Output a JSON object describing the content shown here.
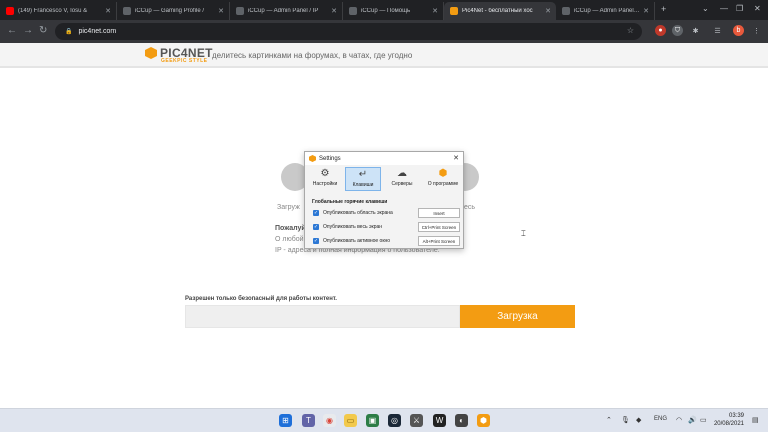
{
  "browser": {
    "tabs": [
      {
        "title": "(149) Francesco V, Iosu &",
        "favicon": "youtube-icon",
        "color": "#ff0000"
      },
      {
        "title": "iCCup — Gaming Profile /",
        "favicon": "iccup-icon",
        "color": "#5f6368"
      },
      {
        "title": "iCCup — Admin Panel / IP",
        "favicon": "iccup-icon",
        "color": "#5f6368"
      },
      {
        "title": "iCCup — Помощь",
        "favicon": "iccup-icon",
        "color": "#5f6368"
      },
      {
        "title": "Pic4Net - бесплатный хос",
        "favicon": "pic4net-icon",
        "color": "#f39c12",
        "active": true
      },
      {
        "title": "iCCup — Admin Panel / IP",
        "favicon": "iccup-icon",
        "color": "#5f6368"
      }
    ],
    "new_tab": "+",
    "url": "pic4net.com"
  },
  "site": {
    "logo_name": "PIC4NET",
    "logo_sub": "GEEKPIC STYLE",
    "tagline": "делитесь картинками на форумах, в чатах, где угодно",
    "bg_text_left": "Загруж",
    "bg_text_right": "есь",
    "bg_text_please": "Пожалуй",
    "bg_text_any": "О любой",
    "bg_text_ip": "IP - адреса и полная информация о пользователе.",
    "notice": "Разрешен только безопасный для работы контент.",
    "upload_button": "Загрузка",
    "accent": "#f39c12"
  },
  "dialog": {
    "title": "Settings",
    "tabs": [
      {
        "label": "Настройки",
        "icon": "gear-icon"
      },
      {
        "label": "Клавиши",
        "icon": "keyboard-icon",
        "active": true
      },
      {
        "label": "Серверы",
        "icon": "cloud-upload-icon"
      },
      {
        "label": "О программе",
        "icon": "pic4net-icon"
      }
    ],
    "section_title": "Глобальные горячие клавиши",
    "hotkeys": [
      {
        "label": "Опубликовать область экрана",
        "key": "Insert"
      },
      {
        "label": "Опубликовать весь экран",
        "key": "Ctrl+Print Screen"
      },
      {
        "label": "Опубликовать активное окно",
        "key": "Alt+Print Screen"
      }
    ]
  },
  "taskbar": {
    "lang": "ENG",
    "time": "03:39",
    "date": "20/08/2021"
  }
}
